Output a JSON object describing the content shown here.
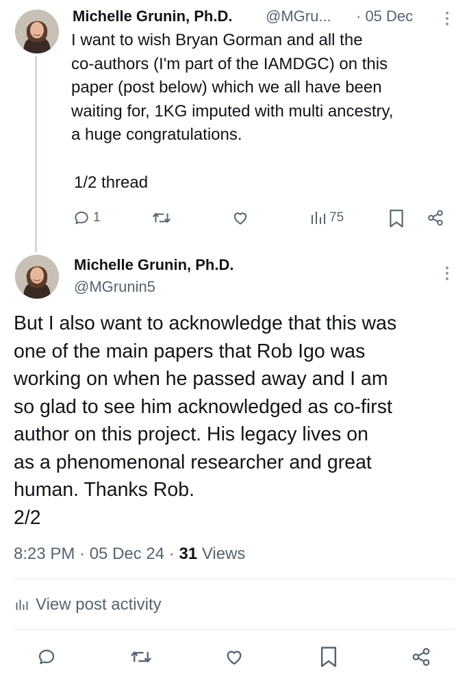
{
  "post1": {
    "author_name": "Michelle Grunin, Ph.D.",
    "handle": "@MGru...",
    "date": "· 05 Dec",
    "text_lines": [
      "I want to wish Bryan Gorman and all the",
      "co-authors (I'm part of the IAMDGC) on this",
      "paper (post below) which we all have been",
      "waiting for, 1KG imputed with multi ancestry,",
      "a huge congratulations."
    ],
    "thread_label": "1/2 thread",
    "reply_count": "1",
    "views_count": "75"
  },
  "post2": {
    "author_name": "Michelle Grunin, Ph.D.",
    "handle": "@MGrunin5",
    "text_lines": [
      "But I also want to acknowledge that this was",
      "one of the main papers that Rob Igo was",
      "working on when he passed away and I am",
      "so glad to see him acknowledged as co-first",
      "author on this project. His legacy lives on",
      "as a phenomenonal researcher and great",
      "human. Thanks Rob.",
      "2/2"
    ],
    "timestamp": "8:23 PM · 05 Dec 24 · ",
    "views_count": "31",
    "views_label": " Views",
    "view_activity_label": "View post activity"
  },
  "icons": {
    "reply": "reply-icon",
    "repost": "repost-icon",
    "like": "like-icon",
    "views": "views-icon",
    "bookmark": "bookmark-icon",
    "share": "share-icon",
    "more": "more-icon"
  },
  "colors": {
    "text": "#0f1419",
    "muted": "#536471",
    "thread_line": "#cfd9de",
    "divider": "#e6e9eb"
  }
}
